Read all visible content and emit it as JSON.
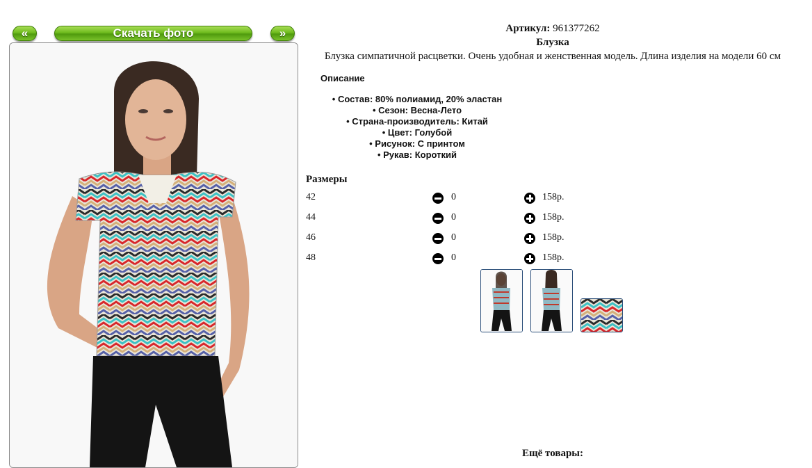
{
  "nav": {
    "prev_label": "«",
    "download_label": "Скачать фото",
    "next_label": "»"
  },
  "product": {
    "article_label": "Артикул:",
    "article_value": "961377262",
    "title": "Блузка",
    "description": "Блузка симпатичной расцветки. Очень удобная и женственная модель. Длина изделия на модели 60 см"
  },
  "specs": {
    "heading": "Описание",
    "items": [
      "Состав: 80% полиамид, 20% эластан",
      "Сезон: Весна-Лето",
      "Страна-производитель: Китай",
      "Цвет: Голубой",
      "Рисунок: С принтом",
      "Рукав: Короткий"
    ]
  },
  "sizes": {
    "heading": "Размеры",
    "rows": [
      {
        "size": "42",
        "qty": "0",
        "price": "158р."
      },
      {
        "size": "44",
        "qty": "0",
        "price": "158р."
      },
      {
        "size": "46",
        "qty": "0",
        "price": "158р."
      },
      {
        "size": "48",
        "qty": "0",
        "price": "158р."
      }
    ]
  },
  "more": {
    "label": "Ещё товары:"
  },
  "colors": {
    "button_green": "#6fbb1e",
    "thumb_border": "#2c4f7a"
  }
}
